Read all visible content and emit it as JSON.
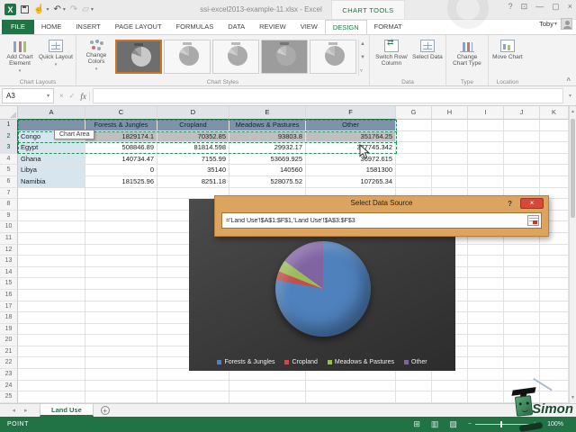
{
  "window": {
    "title": "ssi-excel2013-example-11.xlsx - Excel",
    "context_label": "CHART TOOLS",
    "user": "Toby",
    "controls": {
      "help": "?",
      "ribbon_options": "⊡",
      "minimize": "—",
      "maximize": "▢",
      "close": "×"
    }
  },
  "qat": {
    "icons": [
      "excel-logo",
      "save",
      "touch-mode",
      "undo",
      "redo",
      "open",
      "customize-quick-access"
    ]
  },
  "tabs": {
    "items": [
      "FILE",
      "HOME",
      "INSERT",
      "PAGE LAYOUT",
      "FORMULAS",
      "DATA",
      "REVIEW",
      "VIEW",
      "DESIGN",
      "FORMAT"
    ],
    "active": "DESIGN"
  },
  "ribbon": {
    "add_chart_element": "Add Chart Element",
    "quick_layout": "Quick Layout",
    "change_colors": "Change Colors",
    "switch_row_column": "Switch Row/ Column",
    "select_data": "Select Data",
    "change_chart_type": "Change Chart Type",
    "move_chart": "Move Chart",
    "grp_chart_layouts": "Chart Layouts",
    "grp_chart_styles": "Chart Styles",
    "grp_data": "Data",
    "grp_type": "Type",
    "grp_location": "Location",
    "style_tiles": [
      "style-dark-selected",
      "style-light-1",
      "style-light-2",
      "style-dark-2",
      "style-light-3"
    ]
  },
  "formula_bar": {
    "name_box": "A3",
    "value": ""
  },
  "grid": {
    "columns": [
      {
        "label": "A",
        "sel": true
      },
      {
        "label": "C",
        "sel": true
      },
      {
        "label": "D",
        "sel": true
      },
      {
        "label": "E",
        "sel": true
      },
      {
        "label": "F",
        "sel": true
      },
      {
        "label": "G",
        "sel": false
      },
      {
        "label": "H",
        "sel": false
      },
      {
        "label": "I",
        "sel": false
      },
      {
        "label": "J",
        "sel": false
      },
      {
        "label": "K",
        "sel": false
      }
    ],
    "row_count": 25
  },
  "sheet": {
    "name": "Land Use",
    "header_row": [
      "Forests & Jungles",
      "Cropland",
      "Meadows & Pastures",
      "Other"
    ],
    "rows": [
      {
        "name": "Congo",
        "values": [
          "1829174.1",
          "70352.85",
          "93803.8",
          "351764.25"
        ]
      },
      {
        "name": "Egypt",
        "values": [
          "508846.89",
          "81814.598",
          "29932.17",
          "377745.342"
        ]
      },
      {
        "name": "Ghana",
        "values": [
          "140734.47",
          "7155.99",
          "53669.925",
          "36972.615"
        ]
      },
      {
        "name": "Libya",
        "values": [
          "0",
          "35140",
          "140560",
          "1581300"
        ]
      },
      {
        "name": "Namibia",
        "values": [
          "181525.96",
          "8251.18",
          "528075.52",
          "107265.34"
        ]
      }
    ]
  },
  "ui": {
    "tooltip": "Chart Area"
  },
  "dialog": {
    "title": "Select Data Source",
    "formula": "='Land Use'!$A$1:$F$1,'Land Use'!$A$3:$F$3",
    "help": "?",
    "close": "×"
  },
  "chart_data": {
    "type": "pie",
    "title": "",
    "categories": [
      "Forests & Jungles",
      "Cropland",
      "Meadows & Pastures",
      "Other"
    ],
    "values": [
      1829174.1,
      70352.85,
      93803.8,
      351764.25
    ],
    "series_source": "Congo (row 2)",
    "legend_position": "bottom",
    "colors": [
      "#4f81bd",
      "#c0504d",
      "#9bbb59",
      "#8064a2"
    ],
    "background": "#3a3a3a"
  },
  "sheet_tabs": {
    "active": "Land Use",
    "add_label": "+",
    "nav_prev": "◂",
    "nav_next": "▸"
  },
  "status": {
    "mode": "POINT",
    "zoom": "100%",
    "view_icons": [
      "normal-view",
      "page-layout-view",
      "page-break-view"
    ]
  },
  "logo": {
    "text": "Simon"
  },
  "colors": {
    "excel_green": "#217346",
    "dialog_frame": "#dca45e",
    "selected_header_fill": "#7e93aa",
    "source_row_fill": "#bfbfbf",
    "category_fill": "#d6e5ee"
  }
}
